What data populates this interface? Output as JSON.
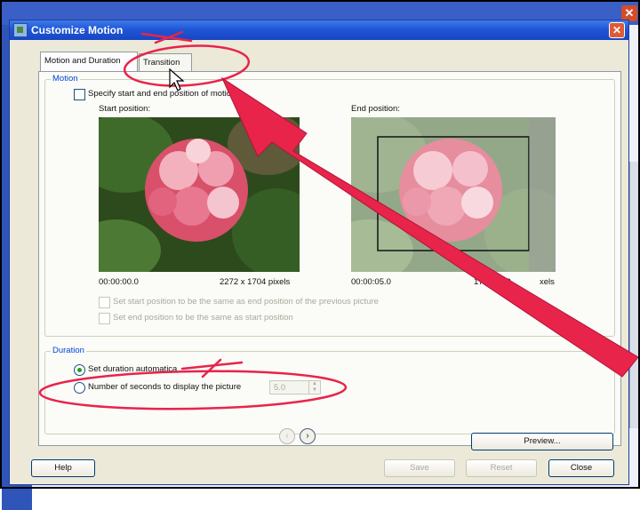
{
  "dialog": {
    "title": "Customize Motion",
    "close_glyph": "✕",
    "tabs": [
      "Motion and Duration",
      "Transition"
    ],
    "motion": {
      "group_label": "Motion",
      "specify_label": "Specify start and end position of motion",
      "start_label": "Start position:",
      "end_label": "End position:",
      "start_time": "00:00:00.0",
      "start_size": "2272 x 1704 pixels",
      "end_time": "00:00:05.0",
      "end_size": "1704 x 12",
      "end_size_tail": "xels",
      "set_start_same": "Set start position to be the same as end position of the previous picture",
      "set_end_same": "Set end position to be the same as start position"
    },
    "duration": {
      "group_label": "Duration",
      "auto_label": "Set duration automatica",
      "seconds_label": "Number of seconds to display the picture",
      "seconds_value": "5.0"
    },
    "buttons": {
      "preview": "Preview...",
      "help": "Help",
      "save": "Save",
      "reset": "Reset",
      "close": "Close"
    },
    "nav": {
      "prev": "‹",
      "next": "›"
    }
  },
  "colors": {
    "annotation": "#e8244a",
    "title_bar": "#1f56d6"
  },
  "icons": [
    "app-icon",
    "close-icon",
    "cursor-icon",
    "prev-icon",
    "next-icon"
  ]
}
